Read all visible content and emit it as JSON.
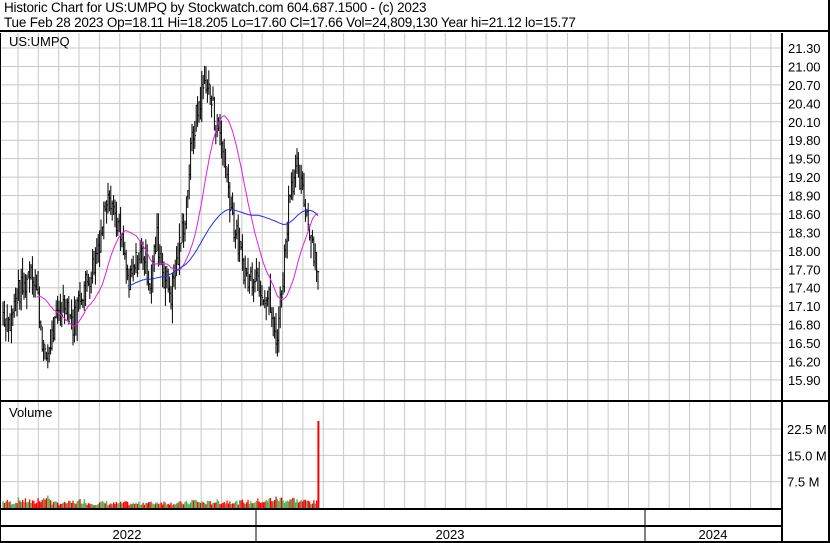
{
  "header": {
    "title": "Historic Chart for US:UMPQ by Stockwatch.com 604.687.1500 - (c) 2023",
    "quote": "Tue Feb 28 2023  Op=18.11  Hi=18.205  Lo=17.60  Cl=17.66  Vol=24,809,130  Year hi=21.12  lo=15.77"
  },
  "chart_data": [
    {
      "type": "line",
      "title": "US:UMPQ",
      "style": "ohlc-bars",
      "ylim": [
        15.75,
        21.45
      ],
      "y_ticks": [
        "21.30",
        "21.00",
        "20.70",
        "20.40",
        "20.10",
        "19.80",
        "19.50",
        "19.20",
        "18.90",
        "18.60",
        "18.30",
        "18.00",
        "17.70",
        "17.40",
        "17.10",
        "16.80",
        "16.50",
        "16.20",
        "15.90"
      ],
      "weekly_close_approx": [
        17.0,
        16.8,
        17.3,
        17.4,
        17.8,
        17.2,
        16.2,
        16.6,
        17.0,
        17.2,
        16.8,
        17.3,
        17.5,
        17.8,
        18.3,
        19.1,
        18.6,
        18.1,
        17.4,
        17.8,
        18.0,
        17.5,
        18.2,
        17.6,
        17.3,
        17.9,
        18.6,
        19.8,
        20.4,
        20.8,
        20.3,
        19.9,
        19.2,
        18.4,
        17.9,
        17.5,
        17.7,
        17.4,
        17.2,
        16.5,
        17.6,
        19.1,
        19.3,
        18.8,
        18.3,
        17.66
      ],
      "moving_averages": [
        {
          "name": "short MA",
          "color": "#e020e0"
        },
        {
          "name": "long MA",
          "color": "#2030e0"
        }
      ],
      "colors": {
        "bar": "#000000"
      }
    },
    {
      "type": "bar",
      "title": "Volume",
      "ylim_millions": [
        0,
        27
      ],
      "y_ticks": [
        "22.5 M",
        "15.0 M",
        "7.5 M"
      ],
      "weekly_volume_millions": [
        1.8,
        1.5,
        2.2,
        2.0,
        1.6,
        2.5,
        2.8,
        1.4,
        1.3,
        1.5,
        1.7,
        2.0,
        1.4,
        1.3,
        1.5,
        1.2,
        1.3,
        1.4,
        1.2,
        1.3,
        1.5,
        1.4,
        1.6,
        1.5,
        1.3,
        1.4,
        1.5,
        2.0,
        1.6,
        1.5,
        1.8,
        1.7,
        1.9,
        1.6,
        1.8,
        1.7,
        2.0,
        1.9,
        2.4,
        2.5,
        2.2,
        2.4,
        2.0,
        1.9,
        1.6,
        24.8
      ],
      "colors": {
        "up": "#4caf50",
        "down": "#ff0000"
      }
    }
  ],
  "x_axis": {
    "years": [
      "2022",
      "2023",
      "2024"
    ]
  }
}
